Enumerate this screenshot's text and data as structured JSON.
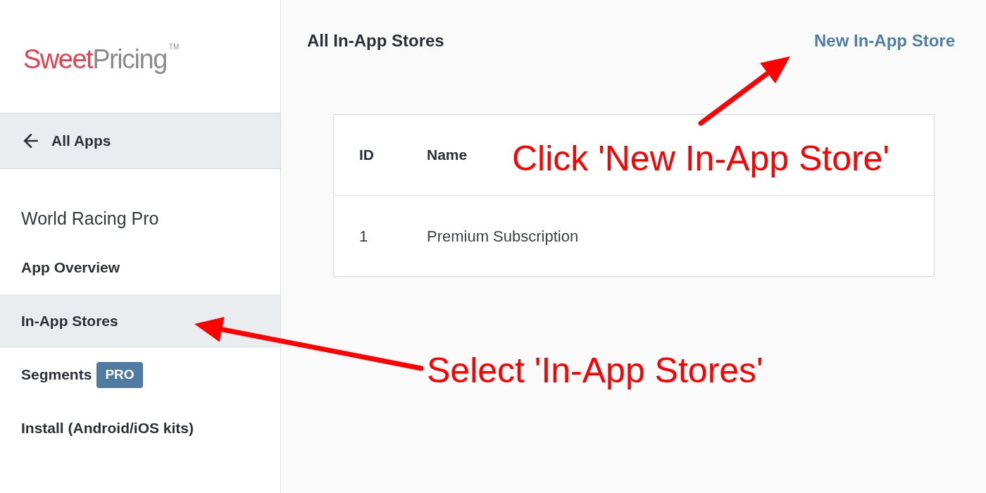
{
  "sidebar": {
    "logo": {
      "primary": "Sweet",
      "secondary": "Pricing",
      "mark": "TM"
    },
    "back_link": {
      "label": "All Apps"
    },
    "app_name": "World Racing Pro",
    "items": [
      {
        "label": "App Overview",
        "selected": false
      },
      {
        "label": "In-App Stores",
        "selected": true
      },
      {
        "label": "Segments",
        "selected": false,
        "badge": "PRO"
      },
      {
        "label": "Install (Android/iOS kits)",
        "selected": false
      }
    ]
  },
  "main": {
    "title": "All In-App Stores",
    "action": "New In-App Store",
    "table": {
      "columns": [
        "ID",
        "Name"
      ],
      "rows": [
        [
          "1",
          "Premium Subscription"
        ]
      ]
    }
  },
  "annotations": [
    {
      "text": "Click 'New In-App Store'"
    },
    {
      "text": "Select 'In-App Stores'"
    }
  ]
}
